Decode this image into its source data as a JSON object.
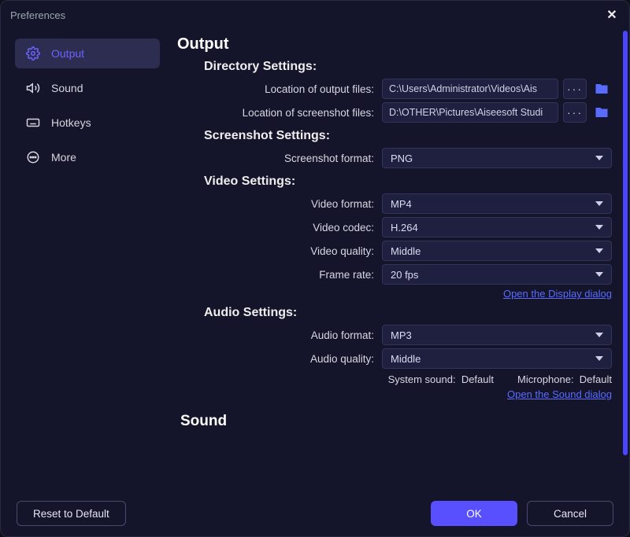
{
  "window": {
    "title": "Preferences"
  },
  "sidebar": {
    "items": [
      {
        "label": "Output"
      },
      {
        "label": "Sound"
      },
      {
        "label": "Hotkeys"
      },
      {
        "label": "More"
      }
    ]
  },
  "output": {
    "heading": "Output",
    "directory": {
      "heading": "Directory Settings:",
      "output_label": "Location of output files:",
      "output_value": "C:\\Users\\Administrator\\Videos\\Ais",
      "screenshot_label": "Location of screenshot files:",
      "screenshot_value": "D:\\OTHER\\Pictures\\Aiseesoft Studi"
    },
    "screenshot": {
      "heading": "Screenshot Settings:",
      "format_label": "Screenshot format:",
      "format_value": "PNG"
    },
    "video": {
      "heading": "Video Settings:",
      "format_label": "Video format:",
      "format_value": "MP4",
      "codec_label": "Video codec:",
      "codec_value": "H.264",
      "quality_label": "Video quality:",
      "quality_value": "Middle",
      "framerate_label": "Frame rate:",
      "framerate_value": "20 fps",
      "link": "Open the Display dialog"
    },
    "audio": {
      "heading": "Audio Settings:",
      "format_label": "Audio format:",
      "format_value": "MP3",
      "quality_label": "Audio quality:",
      "quality_value": "Middle",
      "system_label": "System sound:",
      "system_value": "Default",
      "mic_label": "Microphone:",
      "mic_value": "Default",
      "link": "Open the Sound dialog"
    }
  },
  "sound": {
    "heading": "Sound"
  },
  "footer": {
    "reset": "Reset to Default",
    "ok": "OK",
    "cancel": "Cancel"
  }
}
